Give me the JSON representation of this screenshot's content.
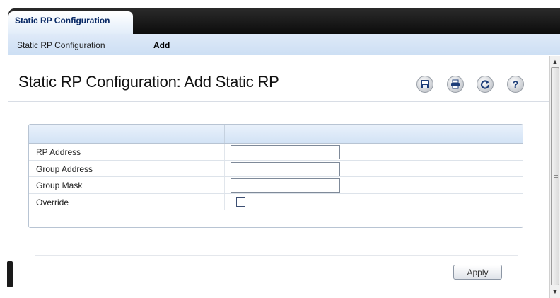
{
  "tabs": [
    {
      "label": "Static RP Configuration",
      "active": true
    }
  ],
  "subnav": {
    "items": [
      {
        "label": "Static RP Configuration"
      },
      {
        "label": "Add",
        "selected": true
      }
    ]
  },
  "page": {
    "title": "Static RP Configuration: Add Static RP"
  },
  "toolbar": {
    "icons": [
      "save-icon",
      "print-icon",
      "refresh-icon",
      "help-icon"
    ]
  },
  "form": {
    "fields": [
      {
        "label": "RP Address",
        "type": "text",
        "value": ""
      },
      {
        "label": "Group Address",
        "type": "text",
        "value": ""
      },
      {
        "label": "Group Mask",
        "type": "text",
        "value": ""
      },
      {
        "label": "Override",
        "type": "checkbox",
        "checked": false
      }
    ]
  },
  "actions": {
    "apply_label": "Apply"
  },
  "colors": {
    "tabbar": "#0c0c0c",
    "subnav": "#cddff4",
    "header_row": "#d3e3f5"
  }
}
